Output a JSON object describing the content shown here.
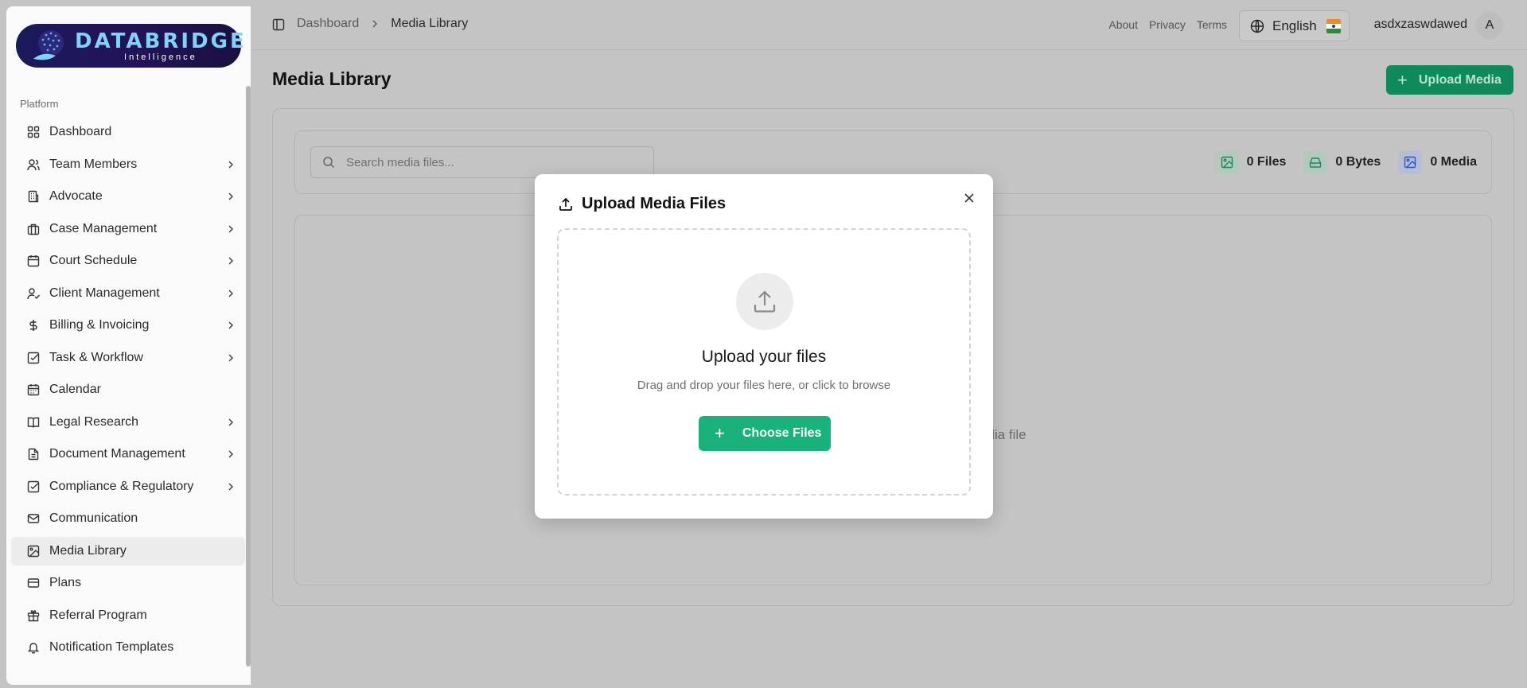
{
  "brand": {
    "name": "DATABRIDGE",
    "tagline": "Intelligence"
  },
  "sidebar": {
    "section": "Platform",
    "items": [
      {
        "label": "Dashboard",
        "icon": "dashboard-icon",
        "chevron": false
      },
      {
        "label": "Team Members",
        "icon": "users-icon",
        "chevron": true
      },
      {
        "label": "Advocate",
        "icon": "building-icon",
        "chevron": true
      },
      {
        "label": "Case Management",
        "icon": "briefcase-icon",
        "chevron": true
      },
      {
        "label": "Court Schedule",
        "icon": "calendar-icon",
        "chevron": true
      },
      {
        "label": "Client Management",
        "icon": "user-check-icon",
        "chevron": true
      },
      {
        "label": "Billing & Invoicing",
        "icon": "dollar-icon",
        "chevron": true
      },
      {
        "label": "Task & Workflow",
        "icon": "check-square-icon",
        "chevron": true
      },
      {
        "label": "Calendar",
        "icon": "calendar-icon",
        "chevron": false
      },
      {
        "label": "Legal Research",
        "icon": "book-icon",
        "chevron": true
      },
      {
        "label": "Document Management",
        "icon": "file-icon",
        "chevron": true
      },
      {
        "label": "Compliance & Regulatory",
        "icon": "check-square-icon",
        "chevron": true
      },
      {
        "label": "Communication",
        "icon": "mail-icon",
        "chevron": false
      },
      {
        "label": "Media Library",
        "icon": "image-icon",
        "chevron": false,
        "active": true
      },
      {
        "label": "Plans",
        "icon": "card-icon",
        "chevron": false
      },
      {
        "label": "Referral Program",
        "icon": "gift-icon",
        "chevron": false
      },
      {
        "label": "Notification Templates",
        "icon": "bell-icon",
        "chevron": false
      }
    ]
  },
  "header": {
    "breadcrumb": [
      "Dashboard",
      "Media Library"
    ],
    "links": [
      "About",
      "Privacy",
      "Terms"
    ],
    "language": "English",
    "username": "asdxzaswdawed",
    "avatar_initial": "A"
  },
  "main": {
    "title": "Media Library",
    "upload_button": "Upload Media",
    "search_placeholder": "Search media files...",
    "stats": {
      "files": "0 Files",
      "bytes": "0 Bytes",
      "media": "0 Media"
    },
    "empty_text_partial": "edia file"
  },
  "modal": {
    "title": "Upload Media Files",
    "dropzone_title": "Upload your files",
    "dropzone_subtitle": "Drag and drop your files here, or click to browse",
    "choose_button": "Choose Files"
  },
  "colors": {
    "accent": "#19b27a",
    "brand_text": "#7fd3f7"
  }
}
